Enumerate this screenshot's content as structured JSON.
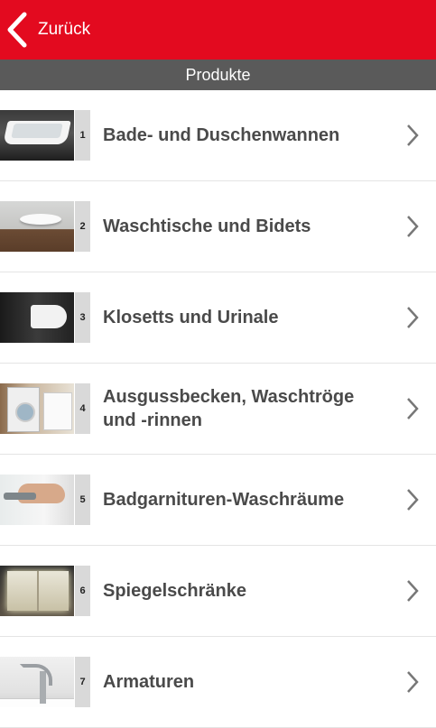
{
  "topbar": {
    "back_label": "Zurück",
    "color": "#e30a1f"
  },
  "section": {
    "title": "Produkte"
  },
  "items": [
    {
      "number": "1",
      "label": "Bade- und Duschenwannen"
    },
    {
      "number": "2",
      "label": "Waschtische und Bidets"
    },
    {
      "number": "3",
      "label": "Klosetts und Urinale"
    },
    {
      "number": "4",
      "label": "Ausgussbecken, Waschtröge und -rinnen"
    },
    {
      "number": "5",
      "label": "Badgarnituren-Waschräume"
    },
    {
      "number": "6",
      "label": "Spiegelschränke"
    },
    {
      "number": "7",
      "label": "Armaturen"
    }
  ]
}
